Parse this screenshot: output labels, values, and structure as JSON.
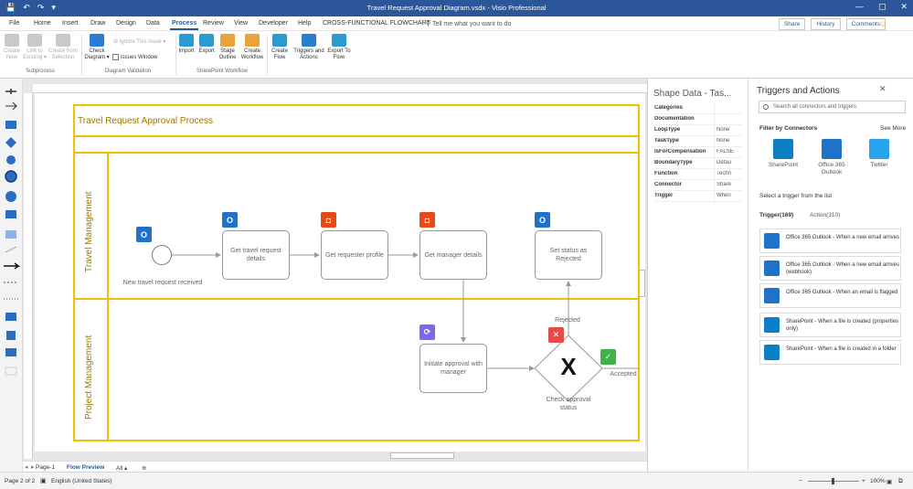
{
  "window": {
    "title": "Travel Request Approval Diagram.vsdx - Visio Professional",
    "qat": [
      "💾",
      "↶",
      "↷",
      "▾"
    ],
    "controls": [
      "—",
      "▢",
      "✕"
    ]
  },
  "tabs": [
    "File",
    "Home",
    "Insert",
    "Draw",
    "Design",
    "Data",
    "Process",
    "Review",
    "View",
    "Developer",
    "Help",
    "CROSS-FUNCTIONAL FLOWCHART"
  ],
  "active_tab": "Process",
  "tell_me": "Tell me what you want to do",
  "top_right": {
    "share": "Share",
    "history": "History",
    "comments": "Comments"
  },
  "ribbon": {
    "create_new": "Create New",
    "link_to_existing": "Link to Existing ▾",
    "create_from_selection": "Create from Selection",
    "check_diagram": "Check Diagram ▾",
    "ignore_this_issue": "Ignore This Issue ▾",
    "issues_window": "Issues Window",
    "import": "Import",
    "export": "Export",
    "stage_outline": "Stage Outline",
    "create_workflow": "Create Workflow",
    "create_flow": "Create Flow",
    "triggers_and_actions": "Triggers and Actions",
    "export_to_flow": "Export To Flow",
    "groups": {
      "subprocess": "Subprocess",
      "diagram_validation": "Diagram Validation",
      "sharepoint_workflow": "SharePoint Workflow"
    }
  },
  "diagram": {
    "pool_title": "Travel Request Approval Process",
    "lanes": [
      "Travel Management",
      "Project Management"
    ],
    "start_event_label": "New travel request received",
    "tasks": {
      "get_travel": "Get travel request details",
      "get_requester": "Get requester profile",
      "get_manager": "Get manager details",
      "set_status": "Set status as Rejected",
      "initiate_approval": "Initiate approval with manager"
    },
    "gateway_label": "Check approval status",
    "gateway_mark": "X",
    "rejected": "Rejected",
    "accepted": "Accepted",
    "icon_glyphs": {
      "outlook": "O",
      "office": "◘",
      "flow": "⟳",
      "reject": "✕",
      "accept": "✓"
    }
  },
  "shape_data": {
    "title": "Shape Data - Tas...",
    "rows": [
      {
        "key": "Categories",
        "value": ""
      },
      {
        "key": "Documentation",
        "value": ""
      },
      {
        "key": "LoopType",
        "value": "None"
      },
      {
        "key": "TaskType",
        "value": "None"
      },
      {
        "key": "IsForCompensation",
        "value": "FALSE"
      },
      {
        "key": "BoundaryType",
        "value": "Defau"
      },
      {
        "key": "Function",
        "value": "Techn"
      },
      {
        "key": "Connector",
        "value": "Share"
      },
      {
        "key": "Trigger",
        "value": "When"
      }
    ]
  },
  "triggers_pane": {
    "title": "Triggers and Actions",
    "close": "✕",
    "search_placeholder": "Search all connectors and triggers",
    "filter_heading": "Filter by Connectors",
    "see_more": "See More",
    "connectors": [
      {
        "label": "SharePoint"
      },
      {
        "label": "Office 365 Outlook"
      },
      {
        "label": "Twitter"
      }
    ],
    "select_heading": "Select a trigger from the list",
    "trigger_tab": "Trigger(169)",
    "action_tab": "Action(310)",
    "triggers": [
      {
        "text": "Office 365 Outlook - When a new email arrives",
        "kind": "o365"
      },
      {
        "text": "Office 365 Outlook - When a new email arrives (webhook)",
        "kind": "o365"
      },
      {
        "text": "Office 365 Outlook - When an email is flagged",
        "kind": "o365"
      },
      {
        "text": "SharePoint - When a file is created (properties only)",
        "kind": "sp"
      },
      {
        "text": "SharePoint - When a file is created in a folder",
        "kind": "sp"
      }
    ]
  },
  "page_tabs": {
    "page1": "Page-1",
    "flow_preview": "Flow Preview",
    "all": "All ▴",
    "add": "⊕"
  },
  "status": {
    "page": "Page 2 of 2",
    "language": "English (United States)",
    "zoom": "100%"
  }
}
